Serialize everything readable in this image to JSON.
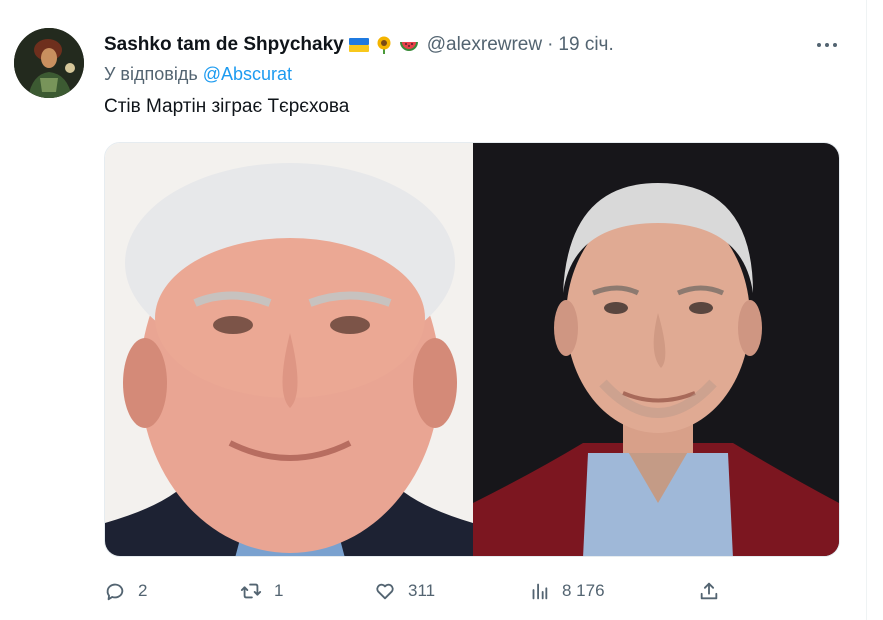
{
  "tweet": {
    "display_name": "Sashko tam de Shpychaky",
    "handle": "@alexrewrew",
    "separator": "·",
    "time": "19 січ.",
    "reply_prefix": "У відповідь",
    "reply_to": "@Abscurat",
    "text": "Стів Мартін зіграє Тєрєхова",
    "name_emojis": [
      "ukraine-flag",
      "sunflower",
      "watermelon"
    ],
    "more_icon": "more-icon"
  },
  "media": {
    "left_image": "portrait-white-haired-man-smiling",
    "right_image": "portrait-grey-haired-man-dark-background"
  },
  "actions": {
    "replies": "2",
    "retweets": "1",
    "likes": "311",
    "views": "8 176",
    "icons": [
      "reply-icon",
      "retweet-icon",
      "like-icon",
      "views-icon",
      "share-icon"
    ]
  }
}
